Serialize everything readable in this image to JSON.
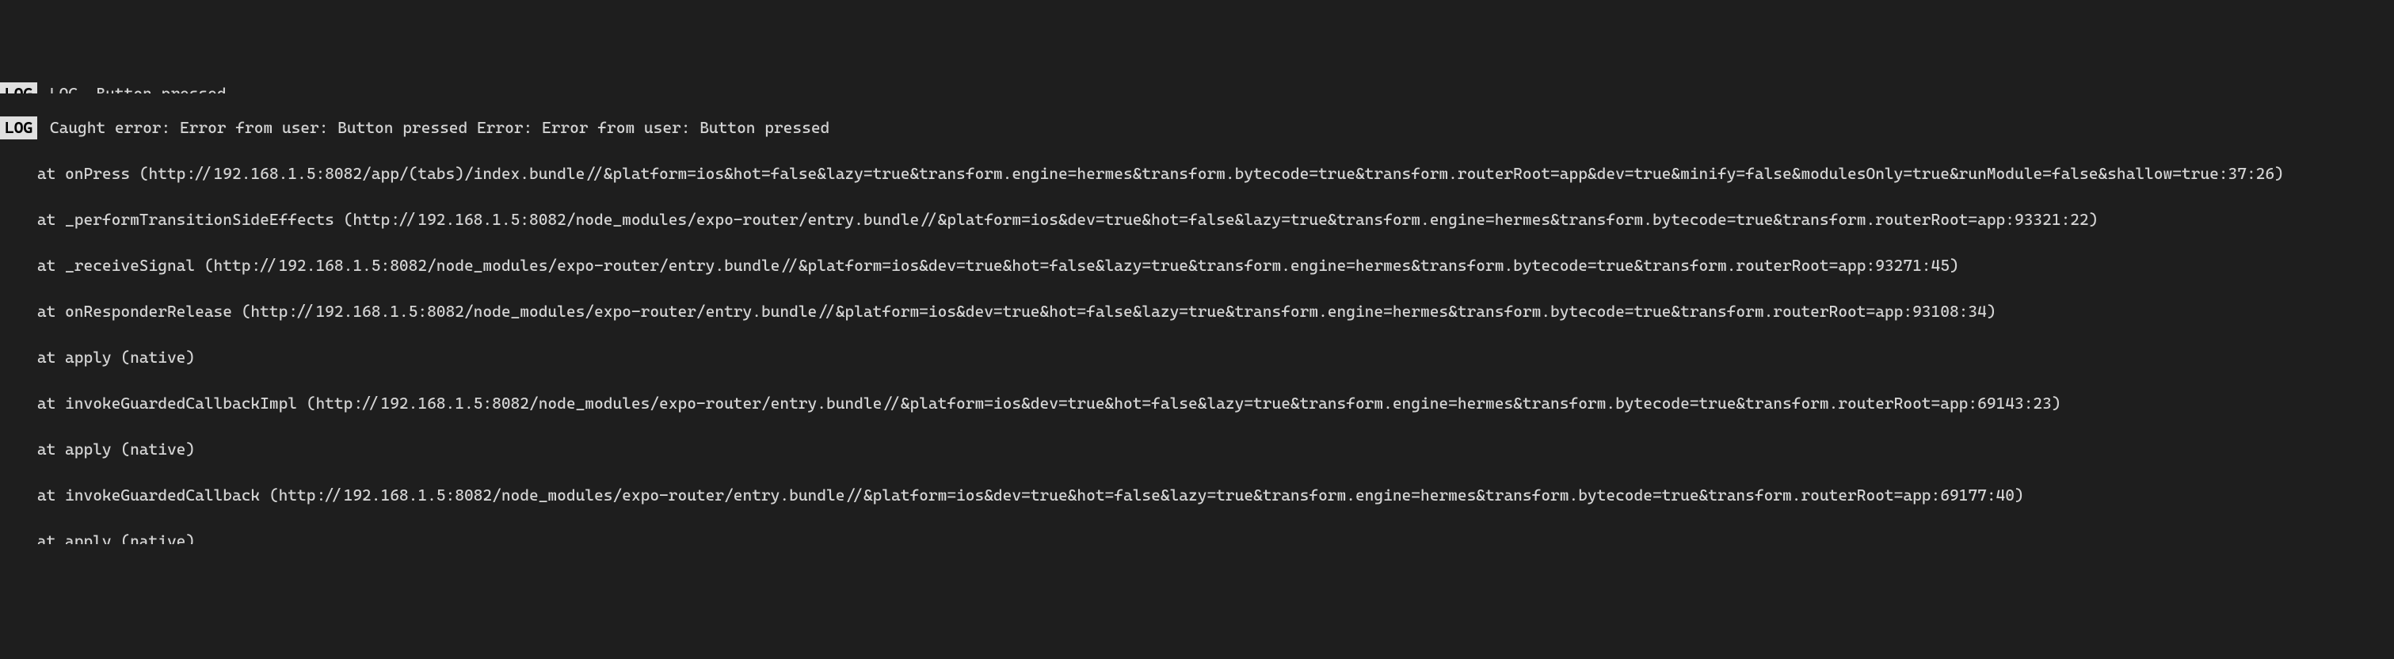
{
  "log_badge": "LOG",
  "partial_top": " LOG  Button pressed",
  "log_message": "Caught error: Error from user: Button pressed Error: Error from user: Button pressed",
  "stack": [
    "    at onPress (http://192.168.1.5:8082/app/(tabs)/index.bundle//&platform=ios&hot=false&lazy=true&transform.engine=hermes&transform.bytecode=true&transform.routerRoot=app&dev=true&minify=false&modulesOnly=true&runModule=false&shallow=true:37:26)",
    "    at _performTransitionSideEffects (http://192.168.1.5:8082/node_modules/expo-router/entry.bundle//&platform=ios&dev=true&hot=false&lazy=true&transform.engine=hermes&transform.bytecode=true&transform.routerRoot=app:93321:22)",
    "    at _receiveSignal (http://192.168.1.5:8082/node_modules/expo-router/entry.bundle//&platform=ios&dev=true&hot=false&lazy=true&transform.engine=hermes&transform.bytecode=true&transform.routerRoot=app:93271:45)",
    "    at onResponderRelease (http://192.168.1.5:8082/node_modules/expo-router/entry.bundle//&platform=ios&dev=true&hot=false&lazy=true&transform.engine=hermes&transform.bytecode=true&transform.routerRoot=app:93108:34)",
    "    at apply (native)",
    "    at invokeGuardedCallbackImpl (http://192.168.1.5:8082/node_modules/expo-router/entry.bundle//&platform=ios&dev=true&hot=false&lazy=true&transform.engine=hermes&transform.bytecode=true&transform.routerRoot=app:69143:23)",
    "    at apply (native)",
    "    at invokeGuardedCallback (http://192.168.1.5:8082/node_modules/expo-router/entry.bundle//&platform=ios&dev=true&hot=false&lazy=true&transform.engine=hermes&transform.bytecode=true&transform.routerRoot=app:69177:40)",
    "    at apply (native)"
  ]
}
